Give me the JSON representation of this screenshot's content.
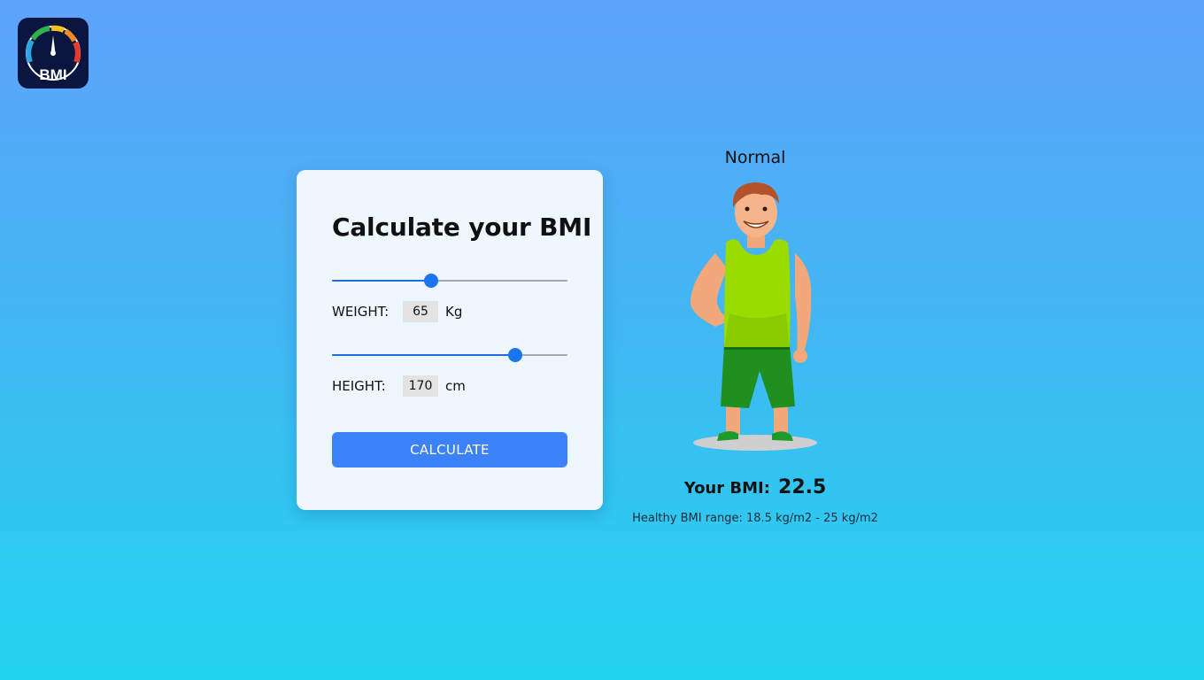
{
  "app": {
    "logo_text": "BMI"
  },
  "calculator": {
    "title": "Calculate your BMI",
    "weight": {
      "label": "WEIGHT:",
      "value": "65",
      "unit": "Kg",
      "slider_fraction": 0.42
    },
    "height": {
      "label": "HEIGHT:",
      "value": "170",
      "unit": "cm",
      "slider_fraction": 0.78
    },
    "calculate_label": "CALCULATE"
  },
  "result": {
    "status": "Normal",
    "bmi_label": "Your BMI:",
    "bmi_value": "22.5",
    "healthy_range": "Healthy BMI range: 18.5 kg/m2 - 25 kg/m2"
  },
  "colors": {
    "accent": "#3b82f6",
    "slider_thumb": "#1b74f0",
    "shirt": "#9bdc00",
    "shorts": "#1f8f1f"
  }
}
